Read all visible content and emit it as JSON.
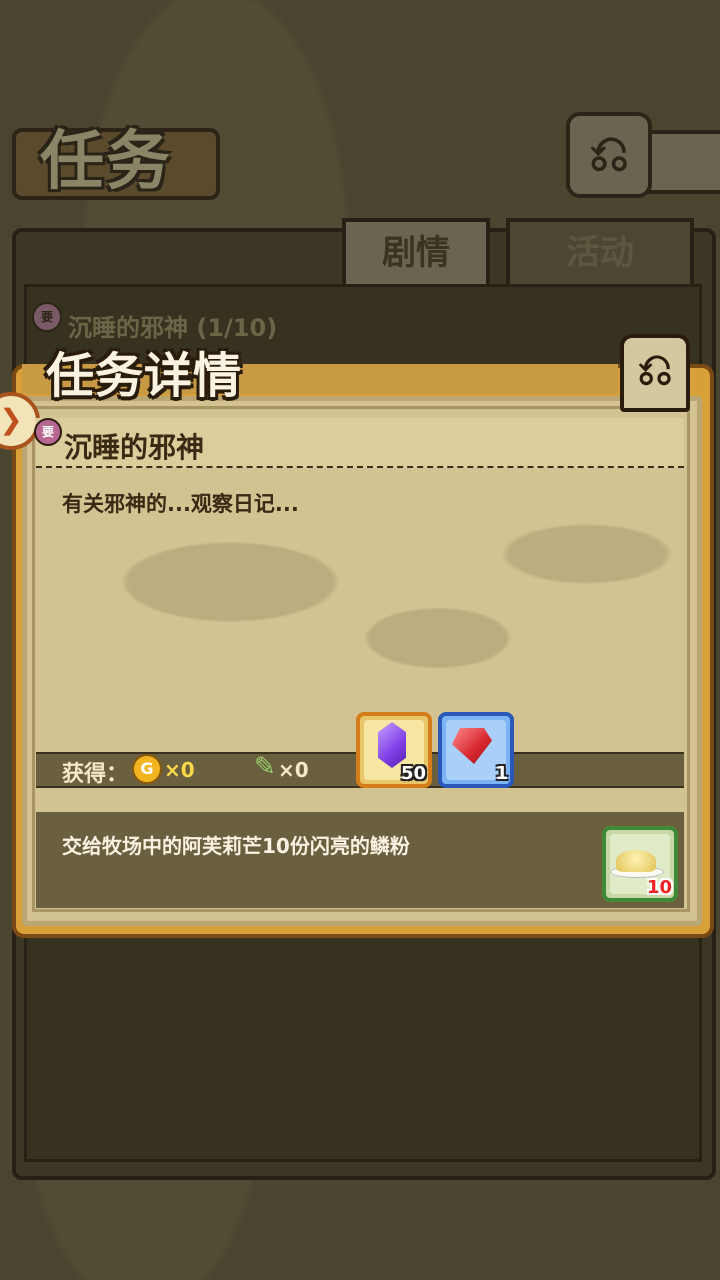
{
  "screen": {
    "title": "任务",
    "back_icon": "return-arrow-icon",
    "tabs": [
      {
        "label": "剧情",
        "active": true
      },
      {
        "label": "活动",
        "active": false
      }
    ],
    "list_row": {
      "badge": "要",
      "title": "沉睡的邪神",
      "progress": "(1/10)"
    }
  },
  "modal": {
    "title": "任务详情",
    "quest": {
      "badge": "要",
      "name": "沉睡的邪神",
      "description": "有关邪神的...观察日记..."
    },
    "rewards": {
      "label": "获得：",
      "coin_symbol": "G",
      "coin_amount": "×0",
      "feather_amount": "×0",
      "items": [
        {
          "icon": "purple-crystal-icon",
          "count": "50"
        },
        {
          "icon": "red-gem-icon",
          "count": "1"
        }
      ]
    },
    "task": {
      "text": "交给牧场中的阿芙莉芒10份闪亮的鳞粉",
      "item_icon": "glitter-powder-icon",
      "item_count": "10"
    }
  },
  "colors": {
    "frame_orange": "#d9a03a",
    "paper": "#d3c393",
    "coin_text": "#f9d84a"
  }
}
